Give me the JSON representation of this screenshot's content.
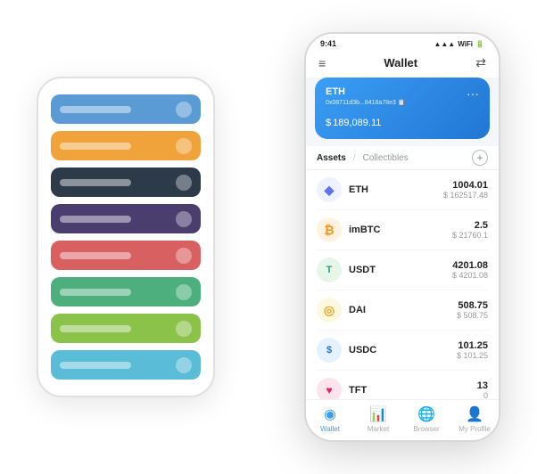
{
  "bgPhone": {
    "cards": [
      {
        "color": "card-blue",
        "id": "card-1"
      },
      {
        "color": "card-orange",
        "id": "card-2"
      },
      {
        "color": "card-dark",
        "id": "card-3"
      },
      {
        "color": "card-purple",
        "id": "card-4"
      },
      {
        "color": "card-red",
        "id": "card-5"
      },
      {
        "color": "card-green",
        "id": "card-6"
      },
      {
        "color": "card-lightgreen",
        "id": "card-7"
      },
      {
        "color": "card-lightblue",
        "id": "card-8"
      }
    ]
  },
  "fgPhone": {
    "statusBar": {
      "time": "9:41",
      "signal": "▲▲▲",
      "wifi": "▾",
      "battery": "▪"
    },
    "header": {
      "menuIcon": "≡",
      "title": "Wallet",
      "scanIcon": "⇄"
    },
    "ethCard": {
      "title": "ETH",
      "address": "0x08711d3b...8418a78e3 📋",
      "dollarSign": "$",
      "balance": "189,089.11",
      "dotsIcon": "···"
    },
    "tabs": {
      "assets": "Assets",
      "divider": "/",
      "collectibles": "Collectibles",
      "addIcon": "+"
    },
    "assets": [
      {
        "symbol": "ETH",
        "icon": "◆",
        "iconClass": "icon-eth",
        "amount": "1004.01",
        "usd": "$ 162517.48"
      },
      {
        "symbol": "imBTC",
        "icon": "₿",
        "iconClass": "icon-imbtc",
        "amount": "2.5",
        "usd": "$ 21760.1"
      },
      {
        "symbol": "USDT",
        "icon": "T",
        "iconClass": "icon-usdt",
        "amount": "4201.08",
        "usd": "$ 4201.08"
      },
      {
        "symbol": "DAI",
        "icon": "◎",
        "iconClass": "icon-dai",
        "amount": "508.75",
        "usd": "$ 508.75"
      },
      {
        "symbol": "USDC",
        "icon": "$",
        "iconClass": "icon-usdc",
        "amount": "101.25",
        "usd": "$ 101.25"
      },
      {
        "symbol": "TFT",
        "icon": "♥",
        "iconClass": "icon-tft",
        "amount": "13",
        "usd": "0"
      }
    ],
    "bottomNav": [
      {
        "icon": "◉",
        "label": "Wallet",
        "active": true
      },
      {
        "icon": "📈",
        "label": "Market",
        "active": false
      },
      {
        "icon": "🌐",
        "label": "Browser",
        "active": false
      },
      {
        "icon": "👤",
        "label": "My Profile",
        "active": false
      }
    ]
  }
}
